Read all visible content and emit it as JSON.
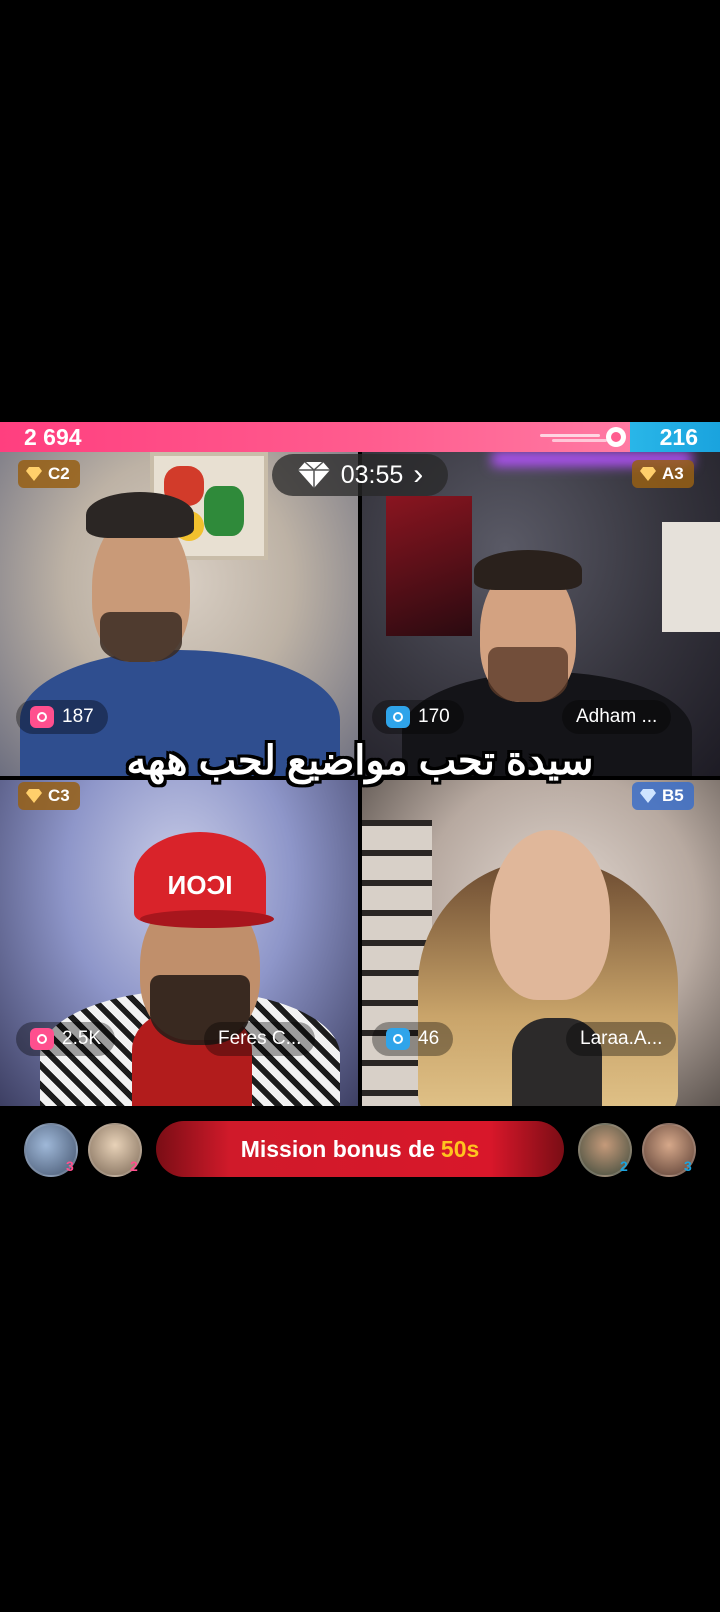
{
  "battle": {
    "left_score": "2 694",
    "right_score": "216",
    "timer": "03:55",
    "timer_chevron": "›"
  },
  "tiles": [
    {
      "rank": "C2",
      "count": "187",
      "name": "",
      "rank_color": "gold",
      "count_color": "pink"
    },
    {
      "rank": "A3",
      "count": "170",
      "name": "Adham ...",
      "rank_color": "gold",
      "count_color": "blue"
    },
    {
      "rank": "C3",
      "count": "2.5K",
      "name": "Feres C...",
      "rank_color": "gold",
      "count_color": "pink"
    },
    {
      "rank": "B5",
      "count": "46",
      "name": "Laraa.A...",
      "rank_color": "blue",
      "count_color": "blue"
    }
  ],
  "caption": "سيدة تحب مواضيع لحب ههه",
  "mission": {
    "text": "Mission bonus de",
    "highlight": "50s"
  },
  "supporters": {
    "left": [
      {
        "num": "3"
      },
      {
        "num": "2"
      }
    ],
    "right": [
      {
        "num": "2"
      },
      {
        "num": "3"
      }
    ]
  },
  "colors": {
    "left_team": "#ff4f8e",
    "right_team": "#1aa3de",
    "mission_highlight": "#ffc31f"
  },
  "icons": [
    "diamond-icon",
    "gem-icon",
    "comet-icon",
    "viewer-icon",
    "chevron-right-icon"
  ]
}
